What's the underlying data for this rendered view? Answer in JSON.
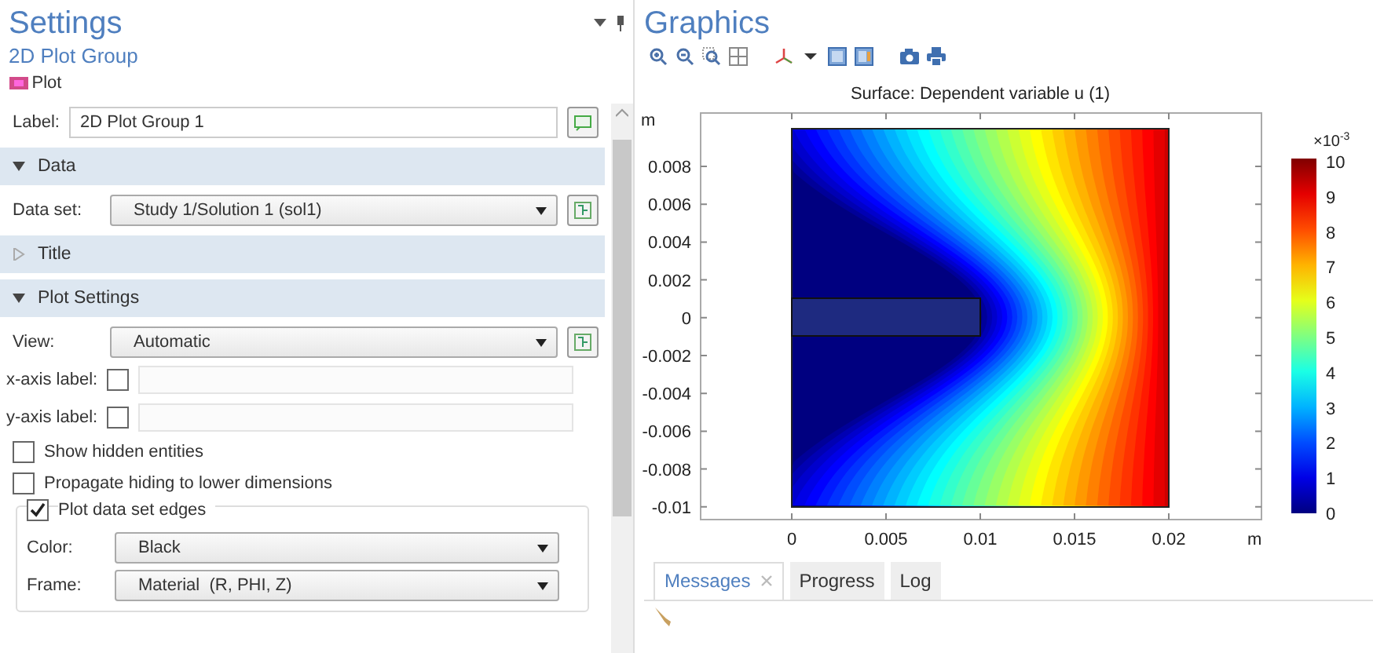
{
  "settings": {
    "title": "Settings",
    "subtitle": "2D Plot Group",
    "node": "Plot",
    "label": {
      "label": "Label:",
      "value": "2D Plot Group 1"
    },
    "sections": [
      {
        "title": "Data",
        "expanded": true,
        "fields": [
          {
            "kind": "select",
            "label": "Data set:",
            "value": "Study 1/Solution 1 (sol1)",
            "reset": true
          }
        ]
      },
      {
        "title": "Title",
        "expanded": false
      },
      {
        "title": "Plot Settings",
        "expanded": true,
        "fields": [
          {
            "kind": "select",
            "label": "View:",
            "value": "Automatic",
            "reset": true
          },
          {
            "kind": "checkbox_text",
            "label": "x-axis label:",
            "checked": false
          },
          {
            "kind": "checkbox_text",
            "label": "y-axis label:",
            "checked": false
          },
          {
            "kind": "checkbox",
            "label": "Show hidden entities",
            "checked": false
          },
          {
            "kind": "checkbox",
            "label": "Propagate hiding to lower dimensions",
            "checked": false
          },
          {
            "kind": "group",
            "label": "Plot data set edges",
            "checked": true,
            "fields": [
              {
                "kind": "select",
                "label": "Color:",
                "value": "Black"
              },
              {
                "kind": "select",
                "label": "Frame:",
                "value": "Material  (R, PHI, Z)"
              }
            ]
          }
        ]
      }
    ]
  },
  "graphics": {
    "title": "Graphics",
    "plot_title": "Surface: Dependent variable u (1)",
    "y_unit": "m",
    "x_unit": "m",
    "xticks": [
      "0",
      "0.005",
      "0.01",
      "0.015",
      "0.02"
    ],
    "yticks": [
      "0.008",
      "0.006",
      "0.004",
      "0.002",
      "0",
      "-0.002",
      "-0.004",
      "-0.006",
      "-0.008",
      "-0.01"
    ],
    "colorbar": {
      "exponent_base": "×10",
      "exponent": "-3",
      "ticks": [
        "10",
        "9",
        "8",
        "7",
        "6",
        "5",
        "4",
        "3",
        "2",
        "1",
        "0"
      ]
    }
  },
  "bottom_tabs": [
    {
      "label": "Messages",
      "selected": true,
      "closable": true
    },
    {
      "label": "Progress",
      "selected": false
    },
    {
      "label": "Log",
      "selected": false
    }
  ]
}
